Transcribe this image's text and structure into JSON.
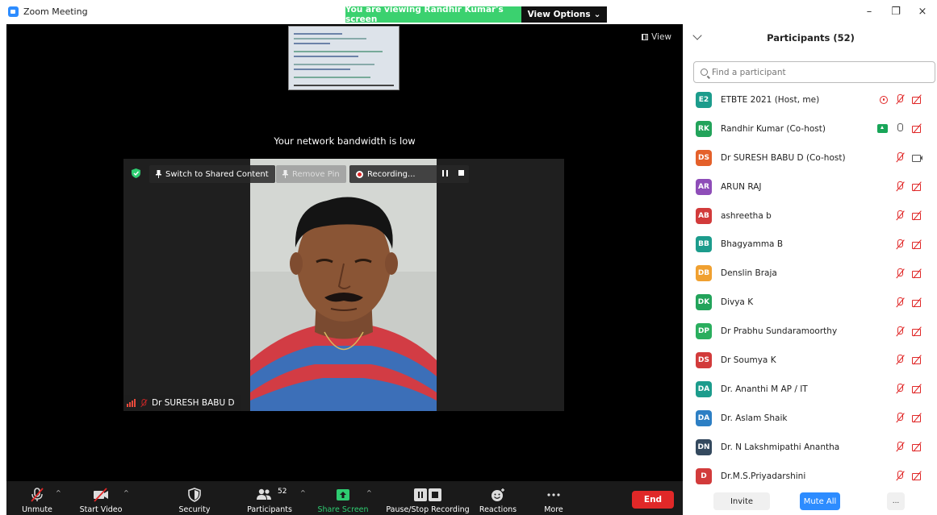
{
  "window": {
    "title": "Zoom Meeting",
    "minimize": "–",
    "maximize": "❐",
    "close": "×"
  },
  "share_banner": {
    "text": "You are viewing Randhir Kumar's screen",
    "view_options": "View Options",
    "caret": "⌄"
  },
  "meeting": {
    "view_label": "View",
    "bandwidth_notice": "Your network bandwidth is low",
    "video_toolbar": {
      "switch_label": "Switch to Shared Content",
      "remove_pin_label": "Remove Pin",
      "recording_label": "Recording..."
    },
    "speaker_name": "Dr SURESH BABU D"
  },
  "toolbar": {
    "caret": "^",
    "unmute": "Unmute",
    "start_video": "Start Video",
    "security": "Security",
    "participants": "Participants",
    "participants_count": "52",
    "share_screen": "Share Screen",
    "pause_recording": "Pause/Stop Recording",
    "reactions": "Reactions",
    "more": "More",
    "end": "End"
  },
  "panel": {
    "title": "Participants (52)",
    "search_placeholder": "Find a participant",
    "participants": [
      {
        "initials": "E2",
        "name": "ETBTE 2021 (Host, me)",
        "color": "#1c9c8c",
        "icons": [
          "host",
          "mic-muted",
          "cam-off"
        ]
      },
      {
        "initials": "RK",
        "name": "Randhir Kumar (Co-host)",
        "color": "#22a35a",
        "icons": [
          "share",
          "mic-on",
          "cam-off"
        ]
      },
      {
        "initials": "DS",
        "name": "Dr SURESH BABU D (Co-host)",
        "color": "#e4602a",
        "icons": [
          "mic-muted",
          "cam-on"
        ]
      },
      {
        "initials": "AR",
        "name": "ARUN RAJ",
        "color": "#8e4db8",
        "icons": [
          "mic-muted",
          "cam-off"
        ]
      },
      {
        "initials": "AB",
        "name": "ashreetha b",
        "color": "#d23b3b",
        "icons": [
          "mic-muted",
          "cam-off"
        ]
      },
      {
        "initials": "BB",
        "name": "Bhagyamma B",
        "color": "#1c9c8c",
        "icons": [
          "mic-muted",
          "cam-off"
        ]
      },
      {
        "initials": "DB",
        "name": "Denslin Braja",
        "color": "#f0a030",
        "icons": [
          "mic-muted",
          "cam-off"
        ]
      },
      {
        "initials": "DK",
        "name": "Divya K",
        "color": "#22a35a",
        "icons": [
          "mic-muted",
          "cam-off"
        ]
      },
      {
        "initials": "DP",
        "name": "Dr Prabhu Sundaramoorthy",
        "color": "#2aae5e",
        "icons": [
          "mic-muted",
          "cam-off"
        ]
      },
      {
        "initials": "DS",
        "name": "Dr Soumya K",
        "color": "#d23b3b",
        "icons": [
          "mic-muted",
          "cam-off"
        ]
      },
      {
        "initials": "DA",
        "name": "Dr. Ananthi M AP / IT",
        "color": "#1c9c8c",
        "icons": [
          "mic-muted",
          "cam-off"
        ]
      },
      {
        "initials": "DA",
        "name": "Dr. Aslam Shaik",
        "color": "#2d7fc4",
        "icons": [
          "mic-muted",
          "cam-off"
        ]
      },
      {
        "initials": "DN",
        "name": "Dr. N Lakshmipathi Anantha",
        "color": "#34495e",
        "icons": [
          "mic-muted",
          "cam-off"
        ]
      },
      {
        "initials": "D",
        "name": "Dr.M.S.Priyadarshini",
        "color": "#d23b3b",
        "icons": [
          "mic-muted",
          "cam-off"
        ]
      }
    ],
    "invite": "Invite",
    "mute_all": "Mute All",
    "more": "..."
  }
}
